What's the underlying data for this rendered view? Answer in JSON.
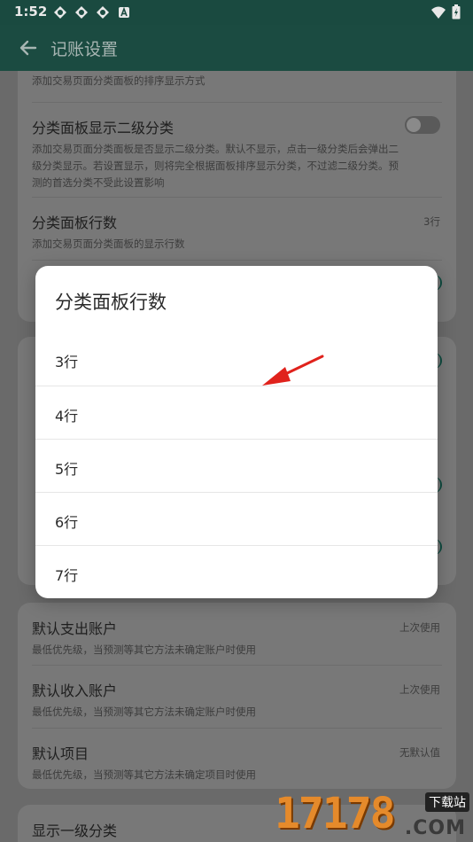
{
  "status_bar": {
    "time": "1:52",
    "icons": [
      "app-icon",
      "app-icon",
      "app-icon",
      "a-icon"
    ],
    "right_icons": [
      "wifi-icon",
      "battery-icon"
    ]
  },
  "header": {
    "title": "记账设置"
  },
  "settings": {
    "row0_subtitle": "添加交易页面分类面板的排序显示方式",
    "row1": {
      "title": "分类面板显示二级分类",
      "subtitle_line1": "添加交易页面分类面板是否显示二级分类。默认不显示，点击一级分类后会弹出二",
      "subtitle_line2": "级分类显示。若设置显示，则将完全根据面板排序显示分类，不过滤二级分类。预",
      "subtitle_line3": "测的首选分类不受此设置影响",
      "toggle_on": false
    },
    "row2": {
      "title": "分类面板行数",
      "subtitle": "添加交易页面分类面板的显示行数",
      "value": "3行"
    },
    "card2": [
      {
        "title": "默认支出账户",
        "subtitle": "最低优先级，当预测等其它方法未确定账户时使用",
        "value": "上次使用"
      },
      {
        "title": "默认收入账户",
        "subtitle": "最低优先级，当预测等其它方法未确定账户时使用",
        "value": "上次使用"
      },
      {
        "title": "默认项目",
        "subtitle": "最低优先级，当预测等其它方法未确定项目时使用",
        "value": "无默认值"
      }
    ],
    "card3_title": "显示一级分类"
  },
  "dialog": {
    "title": "分类面板行数",
    "options": [
      "3行",
      "4行",
      "5行",
      "6行",
      "7行"
    ]
  },
  "colors": {
    "appbar": "#1b4b41",
    "scrim_bg": "#6a6a6a",
    "arrow": "#e0221c"
  },
  "watermark": {
    "number": "17178",
    "badge": "下载站",
    "domain": ".COM"
  }
}
